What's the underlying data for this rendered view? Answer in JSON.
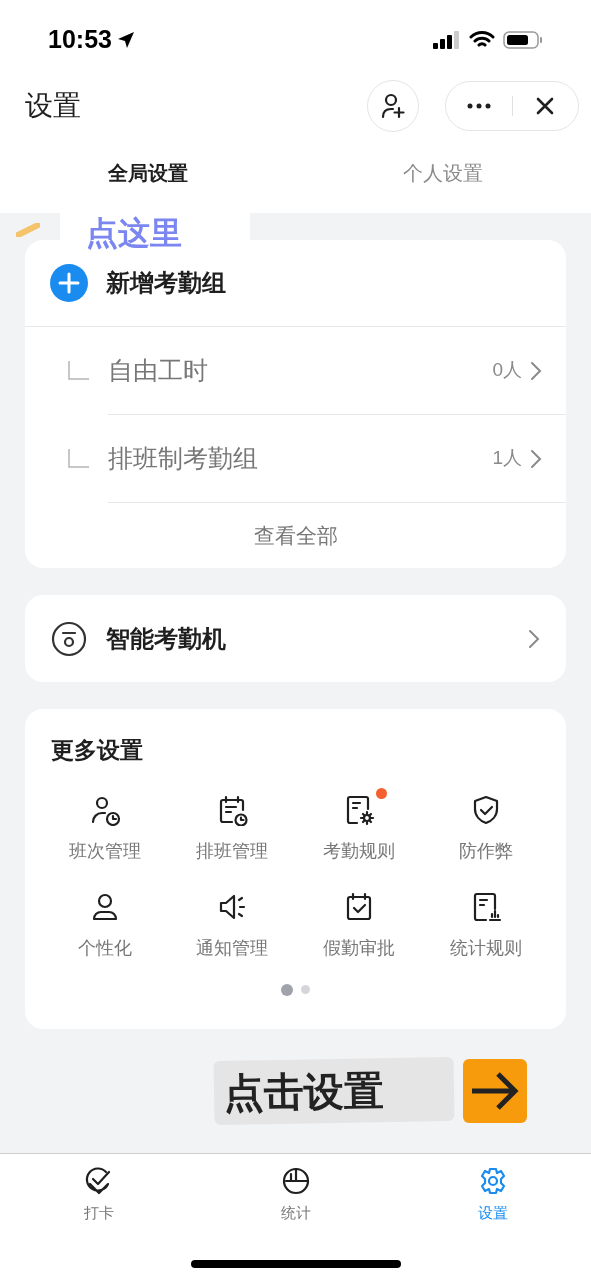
{
  "status_bar": {
    "time": "10:53"
  },
  "header": {
    "title": "设置"
  },
  "tabs": [
    {
      "label": "全局设置",
      "selected": true
    },
    {
      "label": "个人设置",
      "selected": false
    }
  ],
  "hint_top": {
    "text": "点这里"
  },
  "groups_card": {
    "add_label": "新增考勤组",
    "groups": [
      {
        "name": "自由工时",
        "count": "0人"
      },
      {
        "name": "排班制考勤组",
        "count": "1人"
      }
    ],
    "view_all": "查看全部"
  },
  "device_card": {
    "label": "智能考勤机"
  },
  "more_settings": {
    "title": "更多设置",
    "items": [
      {
        "kind": "shift",
        "label": "班次管理",
        "badge": false
      },
      {
        "kind": "schedule",
        "label": "排班管理",
        "badge": false
      },
      {
        "kind": "rules",
        "label": "考勤规则",
        "badge": true
      },
      {
        "kind": "shield",
        "label": "防作弊",
        "badge": false
      },
      {
        "kind": "person",
        "label": "个性化",
        "badge": false
      },
      {
        "kind": "speaker",
        "label": "通知管理",
        "badge": false
      },
      {
        "kind": "calendar",
        "label": "假勤审批",
        "badge": false
      },
      {
        "kind": "stats",
        "label": "统计规则",
        "badge": false
      }
    ],
    "pages": [
      {
        "selected": true
      },
      {
        "selected": false
      }
    ]
  },
  "hint_bottom": {
    "text": "点击设置"
  },
  "tab_bar": [
    {
      "kind": "checkin",
      "label": "打卡",
      "selected": false
    },
    {
      "kind": "stats",
      "label": "统计",
      "selected": false
    },
    {
      "kind": "settings",
      "label": "设置",
      "selected": true
    }
  ]
}
